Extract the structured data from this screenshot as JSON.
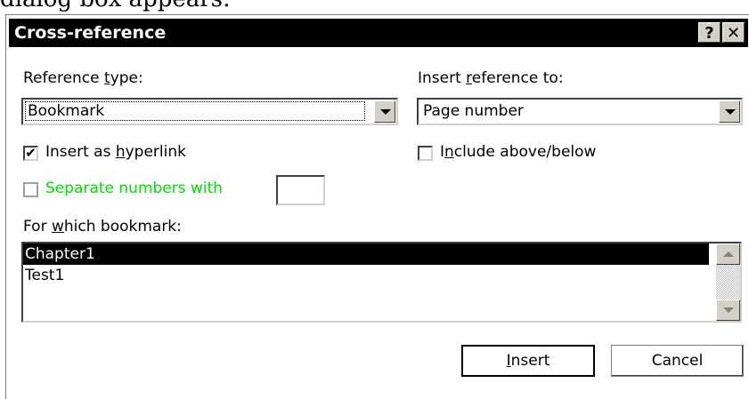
{
  "background_text": "dialog box appears:",
  "dialog": {
    "title": "Cross-reference",
    "help_glyph": "?",
    "close_glyph": "✕"
  },
  "reference_type": {
    "label_pre": "Reference ",
    "label_u": "t",
    "label_post": "ype:",
    "value": "Bookmark"
  },
  "insert_reference_to": {
    "label_pre": "Insert ",
    "label_u": "r",
    "label_post": "eference to:",
    "value": "Page number"
  },
  "insert_as_hyperlink": {
    "label_pre": "Insert as ",
    "label_u": "h",
    "label_post": "yperlink",
    "checked_glyph": "✔"
  },
  "include_above_below": {
    "label_pre": "I",
    "label_u": "n",
    "label_post": "clude above/below"
  },
  "separate_numbers": {
    "label": "Separate numbers with",
    "color": "#00e000",
    "value": ""
  },
  "for_which": {
    "label_pre": "For ",
    "label_u": "w",
    "label_post": "hich bookmark:"
  },
  "bookmarks": [
    "Chapter1",
    "Test1"
  ],
  "buttons": {
    "insert_u": "I",
    "insert_post": "nsert",
    "cancel": "Cancel"
  }
}
